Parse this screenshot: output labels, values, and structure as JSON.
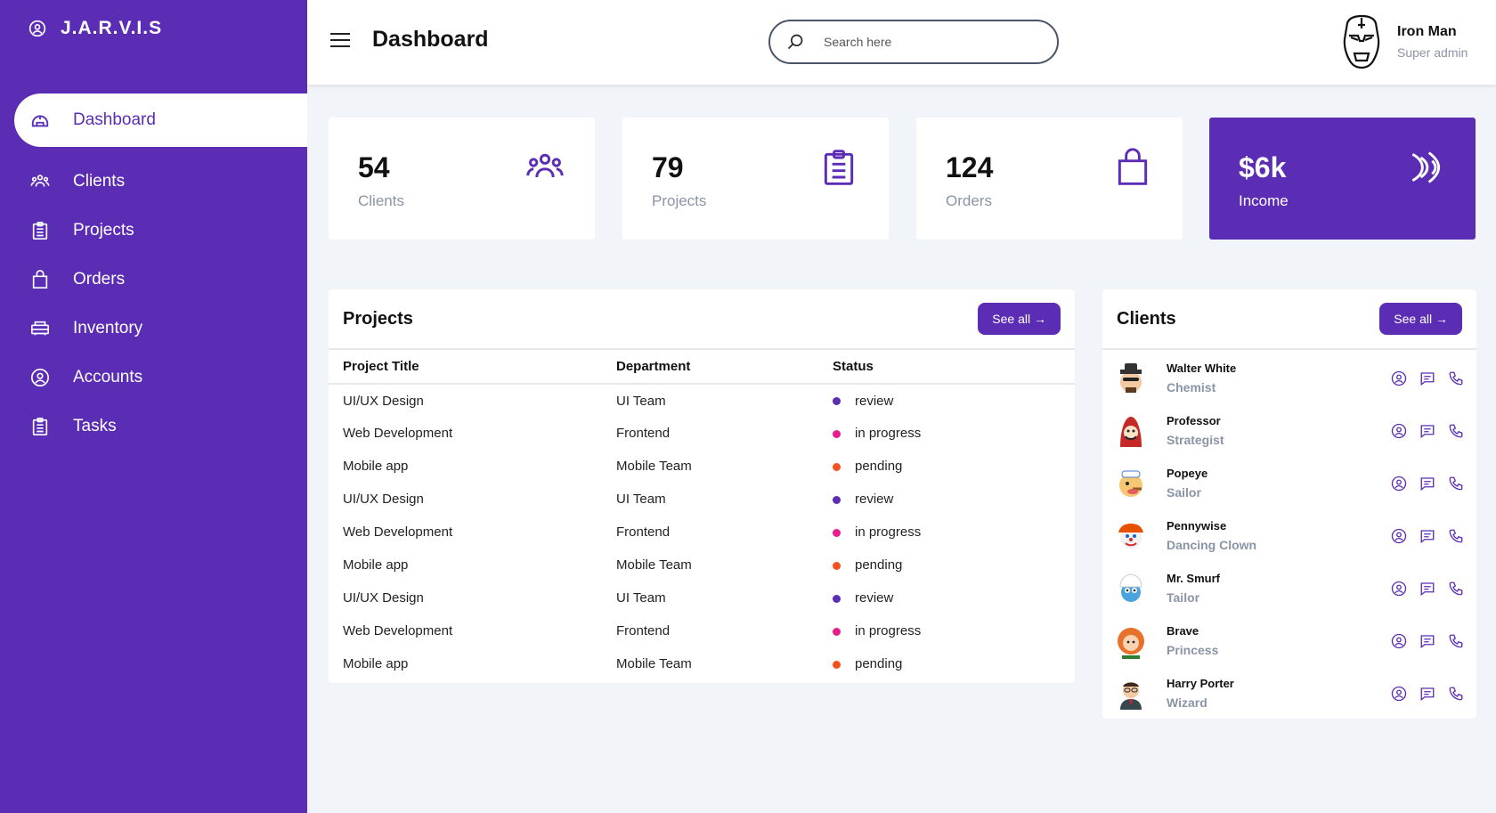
{
  "brand": {
    "title": "J.A.R.V.I.S",
    "icon": "user-circle-icon"
  },
  "sidebar": {
    "items": [
      {
        "label": "Dashboard",
        "icon": "dashboard-icon",
        "active": true
      },
      {
        "label": "Clients",
        "icon": "group-icon"
      },
      {
        "label": "Projects",
        "icon": "clipboard-icon"
      },
      {
        "label": "Orders",
        "icon": "bag-icon"
      },
      {
        "label": "Inventory",
        "icon": "inventory-icon"
      },
      {
        "label": "Accounts",
        "icon": "user-circle-icon"
      },
      {
        "label": "Tasks",
        "icon": "clipboard-icon"
      }
    ]
  },
  "header": {
    "title": "Dashboard",
    "search_placeholder": "Search here",
    "user_name": "Iron Man",
    "user_role": "Super admin"
  },
  "cards": [
    {
      "value": "54",
      "label": "Clients",
      "icon": "group-icon"
    },
    {
      "value": "79",
      "label": "Projects",
      "icon": "clipboard-icon"
    },
    {
      "value": "124",
      "label": "Orders",
      "icon": "bag-icon"
    },
    {
      "value": "$6k",
      "label": "Income",
      "icon": "wave-icon"
    }
  ],
  "projects": {
    "title": "Projects",
    "see_all": "See all →",
    "columns": [
      "Project Title",
      "Department",
      "Status"
    ],
    "rows": [
      {
        "title": "UI/UX Design",
        "department": "UI Team",
        "status": "review"
      },
      {
        "title": "Web Development",
        "department": "Frontend",
        "status": "in progress"
      },
      {
        "title": "Mobile app",
        "department": "Mobile Team",
        "status": "pending"
      },
      {
        "title": "UI/UX Design",
        "department": "UI Team",
        "status": "review"
      },
      {
        "title": "Web Development",
        "department": "Frontend",
        "status": "in progress"
      },
      {
        "title": "Mobile app",
        "department": "Mobile Team",
        "status": "pending"
      },
      {
        "title": "UI/UX Design",
        "department": "UI Team",
        "status": "review"
      },
      {
        "title": "Web Development",
        "department": "Frontend",
        "status": "in progress"
      },
      {
        "title": "Mobile app",
        "department": "Mobile Team",
        "status": "pending"
      }
    ]
  },
  "status_colors": {
    "review": "#5b2db5",
    "in progress": "#e91e8c",
    "pending": "#f4511e"
  },
  "clients": {
    "title": "Clients",
    "see_all": "See all →",
    "items": [
      {
        "name": "Walter White",
        "role": "Chemist"
      },
      {
        "name": "Professor",
        "role": "Strategist"
      },
      {
        "name": "Popeye",
        "role": "Sailor"
      },
      {
        "name": "Pennywise",
        "role": "Dancing Clown"
      },
      {
        "name": "Mr. Smurf",
        "role": "Tailor"
      },
      {
        "name": "Brave",
        "role": "Princess"
      },
      {
        "name": "Harry Porter",
        "role": "Wizard"
      }
    ]
  },
  "colors": {
    "accent": "#5b2db5",
    "muted": "#8a94a6"
  }
}
